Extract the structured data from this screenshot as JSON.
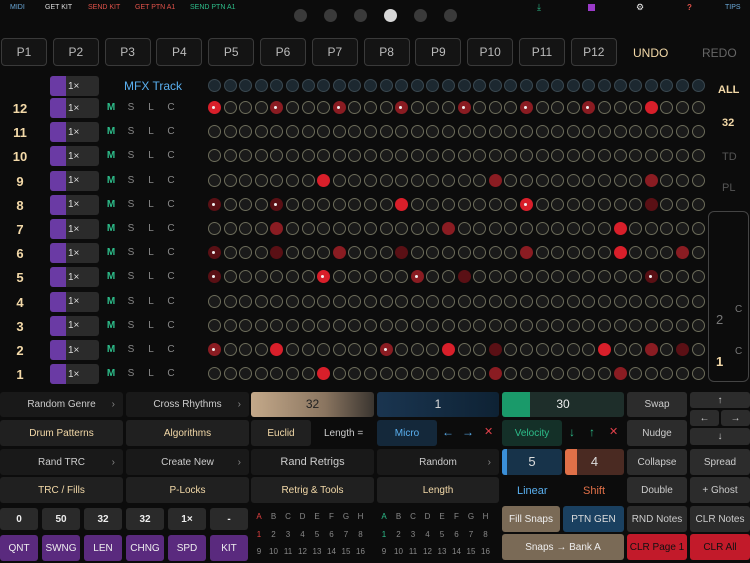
{
  "topbar": {
    "midi": "MIDI",
    "get_kit": "GET KIT",
    "send_kit": "SEND KIT",
    "get_ptn": "GET PTN A1",
    "send_ptn": "SEND PTN A1",
    "tips": "TIPS",
    "help": "?"
  },
  "patterns": [
    "P1",
    "P2",
    "P3",
    "P4",
    "P5",
    "P6",
    "P7",
    "P8",
    "P9",
    "P10",
    "P11",
    "P12"
  ],
  "undo": "UNDO",
  "redo": "REDO",
  "mfx_track": "MFX Track",
  "lane_rate": "1×",
  "msl": [
    "M",
    "S",
    "L",
    "C"
  ],
  "rows": [
    "12",
    "11",
    "10",
    "9",
    "8",
    "7",
    "6",
    "5",
    "4",
    "3",
    "2",
    "1"
  ],
  "right_panel": {
    "all": "ALL",
    "steps": "32",
    "td": "TD",
    "pl": "PL",
    "c1": "C",
    "num2": "2",
    "c2": "C",
    "num1": "1"
  },
  "controls": {
    "random_genre": "Random Genre",
    "cross_rhythms": "Cross Rhythms",
    "drum_patterns": "Drum Patterns",
    "algorithms": "Algorithms",
    "rand_trc": "Rand TRC",
    "create_new": "Create New",
    "trc_fills": "TRC / Fills",
    "p_locks": "P-Locks",
    "steps_value": "32",
    "euclid": "Euclid",
    "length_eq": "Length =",
    "rand_retrigs": "Rand Retrigs",
    "retrig_tools": "Retrig & Tools",
    "micro_value": "1",
    "micro": "Micro",
    "random": "Random",
    "length": "Length",
    "velocity_value": "30",
    "velocity": "Velocity",
    "linear_value": "5",
    "shift_value": "4",
    "linear": "Linear",
    "shift": "Shift",
    "fill_snaps": "Fill Snaps",
    "ptn_gen": "PTN GEN",
    "snaps_bank": "Snaps → Bank A",
    "swap": "Swap",
    "nudge": "Nudge",
    "collapse": "Collapse",
    "spread": "Spread",
    "double": "Double",
    "ghost": "+ Ghost",
    "rnd_notes": "RND Notes",
    "clr_notes": "CLR Notes",
    "clr_page": "CLR Page 1",
    "clr_all": "CLR All"
  },
  "bottom_values": [
    "0",
    "50",
    "32",
    "32",
    "1×",
    "-"
  ],
  "bottom_labels": [
    "QNT",
    "SWNG",
    "LEN",
    "CHNG",
    "SPD",
    "KIT"
  ],
  "letters": [
    "A",
    "B",
    "C",
    "D",
    "E",
    "F",
    "G",
    "H"
  ],
  "nums_a": [
    "1",
    "2",
    "3",
    "4",
    "5",
    "6",
    "7",
    "8"
  ],
  "nums_b": [
    "9",
    "10",
    "11",
    "12",
    "13",
    "14",
    "15",
    "16"
  ],
  "colors": {
    "accent_orange": "#f3d9a8",
    "purple": "#6a3aa4",
    "red_step": "#d81f2a",
    "teal": "#2dbd8a",
    "blue": "#3a8fd8",
    "clr_red": "#c21a2a"
  }
}
